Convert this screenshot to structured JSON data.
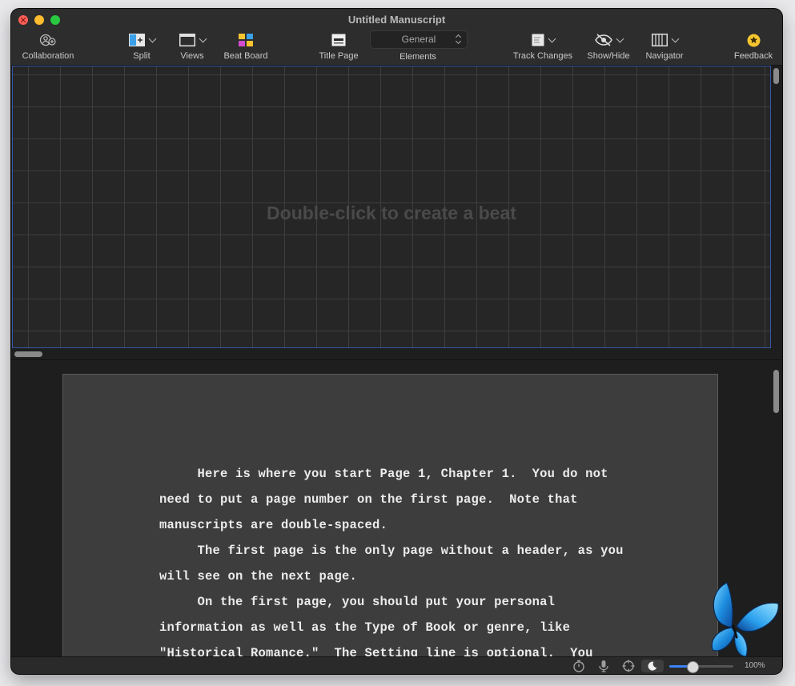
{
  "window": {
    "title": "Untitled Manuscript"
  },
  "toolbar": {
    "collaboration": "Collaboration",
    "split": "Split",
    "views": "Views",
    "beat_board": "Beat Board",
    "title_page": "Title Page",
    "elements_label": "Elements",
    "elements_value": "General",
    "track_changes": "Track Changes",
    "show_hide": "Show/Hide",
    "navigator": "Navigator",
    "feedback": "Feedback"
  },
  "beat_board": {
    "hint": "Double-click to create a beat"
  },
  "manuscript": {
    "lines": [
      "     Here is where you start Page 1, Chapter 1.  You do not",
      "need to put a page number on the first page.  Note that",
      "manuscripts are double-spaced.",
      "     The first page is the only page without a header, as you",
      "will see on the next page.",
      "     On the first page, you should put your personal",
      "information as well as the Type of Book or genre, like",
      "\"Historical Romance.\"  The Setting line is optional.  You"
    ]
  },
  "status_bar": {
    "zoom_label": "100%",
    "zoom_fraction": 0.36
  },
  "icons": {
    "collaboration": "collaboration-icon",
    "split": "split-icon",
    "views": "views-icon",
    "beat_board": "beat-board-icon",
    "title_page": "title-page-icon",
    "track_changes": "track-changes-icon",
    "show_hide": "eye-icon",
    "navigator": "navigator-icon",
    "feedback": "star-icon",
    "timer": "timer-icon",
    "microphone": "microphone-icon",
    "focus": "crosshair-icon",
    "dark_mode": "moon-icon",
    "mascot": "butterfly-icon"
  },
  "colors": {
    "accent": "#3b82f6",
    "beat_board_border": "#3558a8",
    "feedback_star": "#f5c531"
  }
}
